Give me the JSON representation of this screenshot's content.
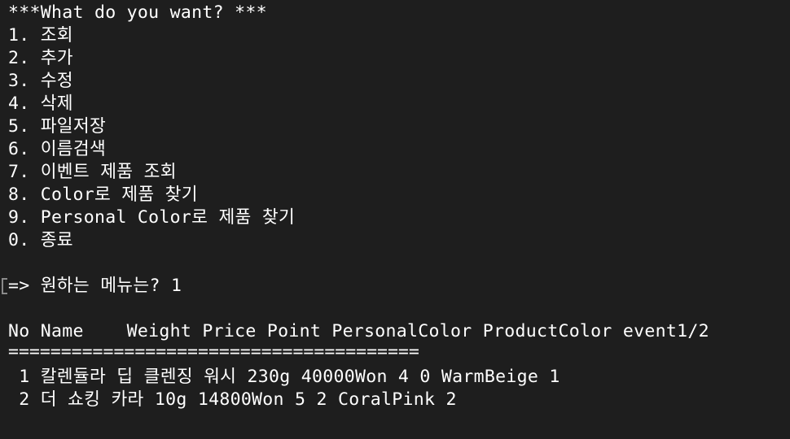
{
  "menu": {
    "title": "***What do you want? ***",
    "items": [
      "1. 조회",
      "2. 추가",
      "3. 수정",
      "4. 삭제",
      "5. 파일저장",
      "6. 이름검색",
      "7. 이벤트 제품 조회",
      "8. Color로 제품 찾기",
      "9. Personal Color로 제품 찾기",
      "0. 종료"
    ]
  },
  "prompt": {
    "text": "=> 원하는 메뉴는? 1"
  },
  "table": {
    "header": "No Name    Weight Price Point PersonalColor ProductColor event1/2",
    "separator": "=======================================",
    "rows": [
      " 1 칼렌듈라 딥 클렌징 워시 230g 40000Won 4 0 WarmBeige 1",
      " 2 더 쇼킹 카라 10g 14800Won 5 2 CoralPink 2"
    ]
  }
}
